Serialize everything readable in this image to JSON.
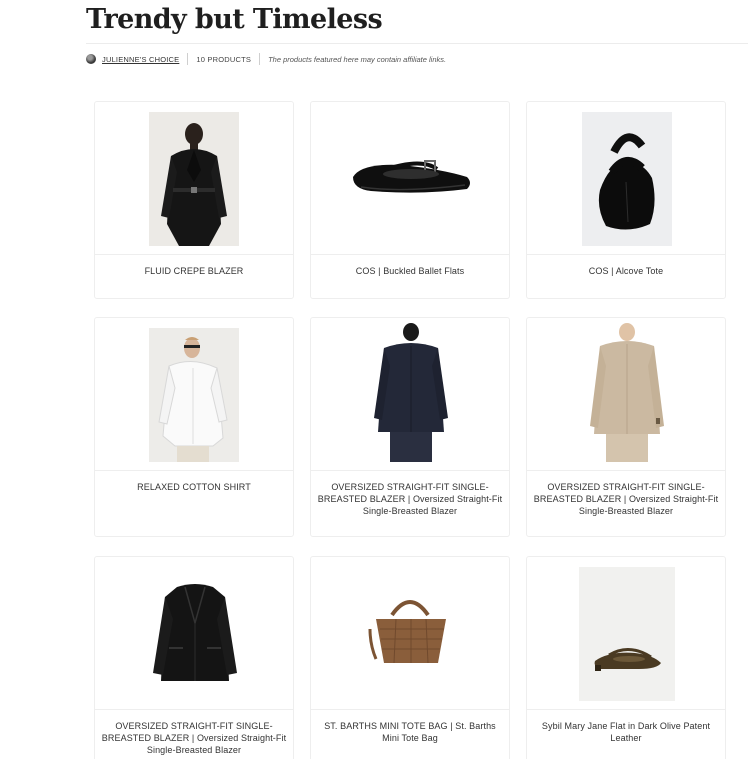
{
  "page": {
    "title": "Trendy but Timeless",
    "author": "JULIENNE'S CHOICE",
    "product_count": "10 PRODUCTS",
    "disclaimer": "The products featured here may contain affiliate links."
  },
  "products": [
    {
      "name": "FLUID CREPE BLAZER",
      "image": "model-black-belted-blazer"
    },
    {
      "name": "COS | Buckled Ballet Flats",
      "image": "black-buckled-ballet-flat"
    },
    {
      "name": "COS | Alcove Tote",
      "image": "black-leather-tote"
    },
    {
      "name": "RELAXED COTTON SHIRT",
      "image": "model-white-cotton-shirt"
    },
    {
      "name": "OVERSIZED STRAIGHT-FIT SINGLE-BREASTED BLAZER | Oversized Straight-Fit Single-Breasted Blazer",
      "image": "navy-blazer-back-view"
    },
    {
      "name": "OVERSIZED STRAIGHT-FIT SINGLE-BREASTED BLAZER | Oversized Straight-Fit Single-Breasted Blazer",
      "image": "beige-blazer-back-view"
    },
    {
      "name": "OVERSIZED STRAIGHT-FIT SINGLE-BREASTED BLAZER | Oversized Straight-Fit Single-Breasted Blazer",
      "image": "black-blazer-flat"
    },
    {
      "name": "ST. BARTHS MINI TOTE BAG | St. Barths Mini Tote Bag",
      "image": "woven-brown-tote"
    },
    {
      "name": "Sybil Mary Jane Flat in Dark Olive Patent Leather",
      "image": "olive-patent-mary-jane"
    }
  ]
}
